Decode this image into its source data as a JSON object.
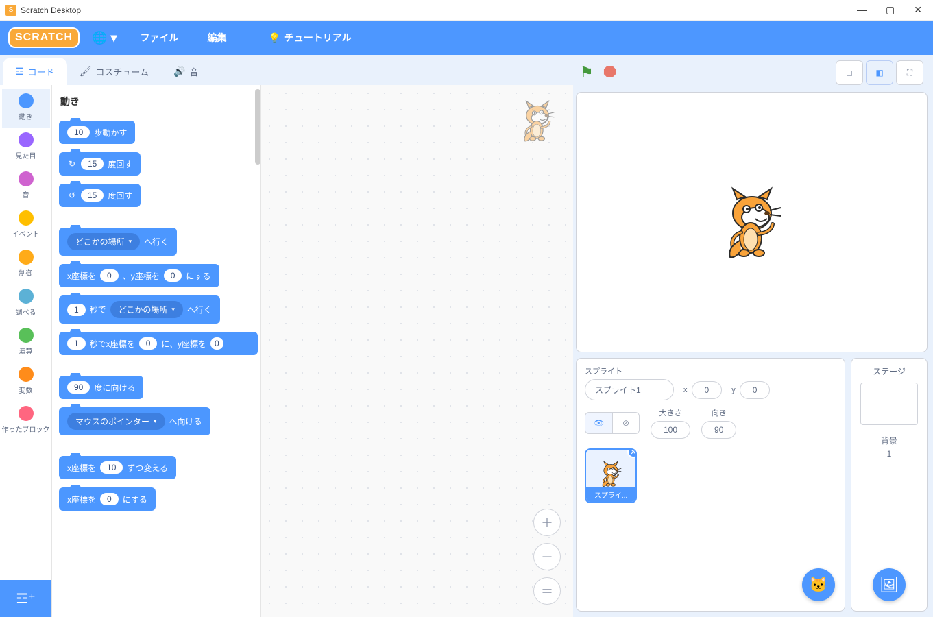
{
  "window": {
    "title": "Scratch Desktop"
  },
  "menubar": {
    "logo": "SCRATCH",
    "file": "ファイル",
    "edit": "編集",
    "tutorials": "チュートリアル"
  },
  "tabs": {
    "code": "コード",
    "costumes": "コスチューム",
    "sounds": "音"
  },
  "categories": [
    {
      "id": "motion",
      "label": "動き",
      "color": "#4c97ff"
    },
    {
      "id": "looks",
      "label": "見た目",
      "color": "#9966ff"
    },
    {
      "id": "sound",
      "label": "音",
      "color": "#cf63cf"
    },
    {
      "id": "events",
      "label": "イベント",
      "color": "#ffbf00"
    },
    {
      "id": "control",
      "label": "制御",
      "color": "#ffab19"
    },
    {
      "id": "sensing",
      "label": "調べる",
      "color": "#5cb1d6"
    },
    {
      "id": "operators",
      "label": "演算",
      "color": "#59c059"
    },
    {
      "id": "variables",
      "label": "変数",
      "color": "#ff8c1a"
    },
    {
      "id": "myblocks",
      "label": "作ったブロック",
      "color": "#ff6680"
    }
  ],
  "palette": {
    "heading": "動き",
    "blocks": {
      "move_steps": {
        "val": "10",
        "text": "歩動かす"
      },
      "turn_cw": {
        "val": "15",
        "text": "度回す"
      },
      "turn_ccw": {
        "val": "15",
        "text": "度回す"
      },
      "goto_menu": {
        "menu": "どこかの場所",
        "text": "へ行く"
      },
      "goto_xy": {
        "pre": "x座標を",
        "x": "0",
        "mid": "、y座標を",
        "y": "0",
        "post": "にする"
      },
      "glide_menu": {
        "secs": "1",
        "t1": "秒で",
        "menu": "どこかの場所",
        "t2": "へ行く"
      },
      "glide_xy": {
        "secs": "1",
        "t1": "秒でx座標を",
        "x": "0",
        "t2": "に、y座標を",
        "y": "0"
      },
      "point_dir": {
        "val": "90",
        "text": "度に向ける"
      },
      "point_towards": {
        "menu": "マウスのポインター",
        "text": "へ向ける"
      },
      "change_x": {
        "pre": "x座標を",
        "val": "10",
        "post": "ずつ変える"
      },
      "set_x": {
        "pre": "x座標を",
        "val": "0",
        "post": "にする"
      }
    }
  },
  "sprite_panel": {
    "title": "スプライト",
    "name": "スプライト1",
    "x_label": "x",
    "x": "0",
    "y_label": "y",
    "y": "0",
    "size_label": "大きさ",
    "size": "100",
    "dir_label": "向き",
    "dir": "90",
    "tile_label": "スプライ..."
  },
  "stage_panel": {
    "title": "ステージ",
    "backdrop_label": "背景",
    "backdrop_count": "1"
  }
}
